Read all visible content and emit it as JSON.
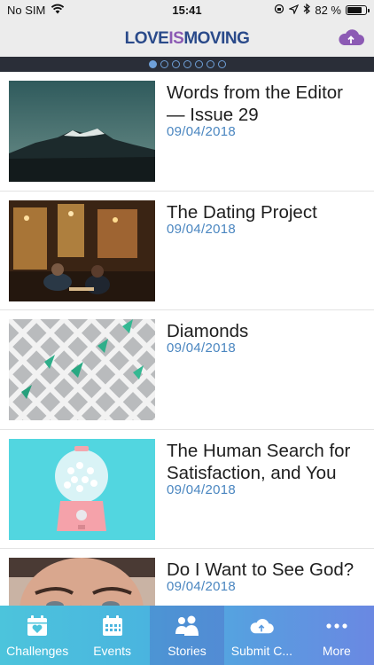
{
  "status_bar": {
    "carrier": "No SIM",
    "time": "15:41",
    "battery_text": "82 %",
    "battery_level": 0.82
  },
  "header": {
    "logo_part1": "LOVE",
    "logo_part2": "IS",
    "logo_part3": "MOVING",
    "action_icon": "cloud-upload-icon"
  },
  "pager": {
    "count": 7,
    "active_index": 0
  },
  "articles": [
    {
      "title": "Words from the Editor — Issue 29",
      "date": "09/04/2018",
      "image": "mountain-photo"
    },
    {
      "title": "The Dating Project",
      "date": "09/04/2018",
      "image": "cafe-couple-photo"
    },
    {
      "title": "Diamonds",
      "date": "09/04/2018",
      "image": "diamond-pattern-photo"
    },
    {
      "title": "The Human Search for Satisfaction, and You",
      "date": "09/04/2018",
      "image": "gumball-machine-photo"
    },
    {
      "title": "Do I Want to See God?",
      "date": "09/04/2018",
      "image": "face-portrait-photo"
    }
  ],
  "tabs": [
    {
      "label": "Challenges",
      "icon": "calendar-heart-icon",
      "active": false
    },
    {
      "label": "Events",
      "icon": "calendar-grid-icon",
      "active": false
    },
    {
      "label": "Stories",
      "icon": "people-icon",
      "active": true
    },
    {
      "label": "Submit C...",
      "icon": "cloud-upload-icon",
      "active": false
    },
    {
      "label": "More",
      "icon": "more-dots-icon",
      "active": false
    }
  ],
  "colors": {
    "date": "#4a86c0",
    "pager_bg": "#2a2e38",
    "tabbar_start": "#4cc4dc",
    "tabbar_end": "#6a88e2",
    "logo_blue": "#2a4a8a",
    "logo_purple": "#8c5ab4"
  }
}
